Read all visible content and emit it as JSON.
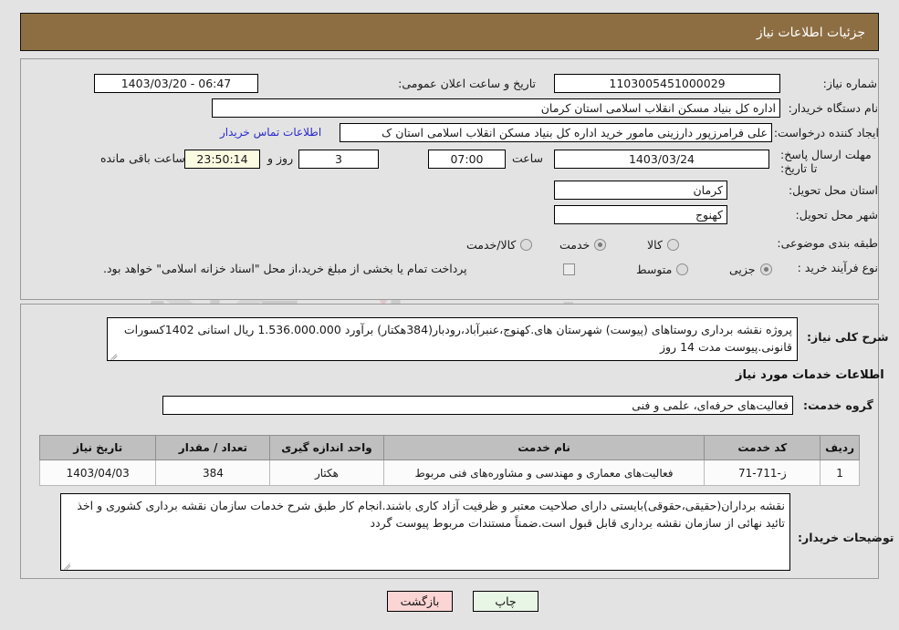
{
  "header": {
    "title": "جزئیات اطلاعات نیاز"
  },
  "watermark": {
    "text": "AriaTender.net"
  },
  "form": {
    "need_number_label": "شماره نیاز:",
    "need_number_value": "1103005451000029",
    "public_announce_label": "تاریخ و ساعت اعلان عمومی:",
    "public_announce_value": "1403/03/20 - 06:47",
    "buyer_org_label": "نام دستگاه خریدار:",
    "buyer_org_value": "اداره کل بنیاد مسکن انقلاب اسلامی استان کرمان",
    "requester_label": "ایجاد کننده درخواست:",
    "requester_value": "علی فرامرزپور دارزینی مامور خرید اداره کل بنیاد مسکن انقلاب اسلامی استان ک",
    "buyer_contact_link": "اطلاعات تماس خریدار",
    "deadline_label": "مهلت ارسال پاسخ: تا تاریخ:",
    "deadline_date": "1403/03/24",
    "hour_label": "ساعت",
    "hour_value": "07:00",
    "days_value": "3",
    "days_label": "روز و",
    "remaining_value": "23:50:14",
    "remaining_label": "ساعت باقی مانده",
    "province_label": "استان محل تحویل:",
    "province_value": "کرمان",
    "city_label": "شهر محل تحویل:",
    "city_value": "کهنوج",
    "category_label": "طبقه بندی موضوعی:",
    "category_options": [
      "کالا",
      "خدمت",
      "کالا/خدمت"
    ],
    "category_selected": "خدمت",
    "process_label": "نوع فرآیند خرید :",
    "process_options": [
      "جزیی",
      "متوسط"
    ],
    "process_selected": "جزیی",
    "treasury_checkbox_label": "پرداخت تمام یا بخشی از مبلغ خرید،از محل \"اسناد خزانه اسلامی\" خواهد بود.",
    "treasury_checked": false
  },
  "summary": {
    "label": "شرح کلی نیاز:",
    "text": "پروژه نقشه برداری روستاهای (پیوست) شهرستان های.کهنوج،عنبرآباد،رودبار(384هکتار) برآورد 1.536.000.000 ریال استانی 1402کسورات قانونی.پیوست مدت 14 روز"
  },
  "services_section": {
    "heading": "اطلاعات خدمات مورد نیاز",
    "group_label": "گروه خدمت:",
    "group_value": "فعالیت‌های حرفه‌ای، علمی و فنی"
  },
  "table": {
    "columns": [
      "ردیف",
      "کد خدمت",
      "نام خدمت",
      "واحد اندازه گیری",
      "تعداد / مقدار",
      "تاریخ نیاز"
    ],
    "rows": [
      {
        "row_no": "1",
        "service_code": "ز-711-71",
        "service_name": "فعالیت‌های معماری و مهندسی و مشاوره‌های فنی مربوط",
        "unit": "هکتار",
        "quantity": "384",
        "need_date": "1403/04/03"
      }
    ]
  },
  "buyer_notes": {
    "label": "توضیحات خریدار:",
    "text": "نقشه برداران(حقیقی،حقوقی)بایستی دارای صلاحیت معتبر و ظرفیت آزاد کاری باشند.انجام کار طبق شرح خدمات سازمان نقشه برداری کشوری و اخذ تائید نهائی از سازمان نقشه برداری قابل قبول است.ضمناً مستندات مربوط پیوست گردد"
  },
  "footer": {
    "print_label": "چاپ",
    "back_label": "بازگشت"
  },
  "colors": {
    "header_bar": "#8d6e43",
    "page_bg": "#e3e3e3",
    "link": "#2a2ad0",
    "table_header": "#bfbfbf",
    "highlight_field": "#fbfbe2",
    "print_button": "#e8f6e5",
    "back_button": "#fbd4d4"
  }
}
